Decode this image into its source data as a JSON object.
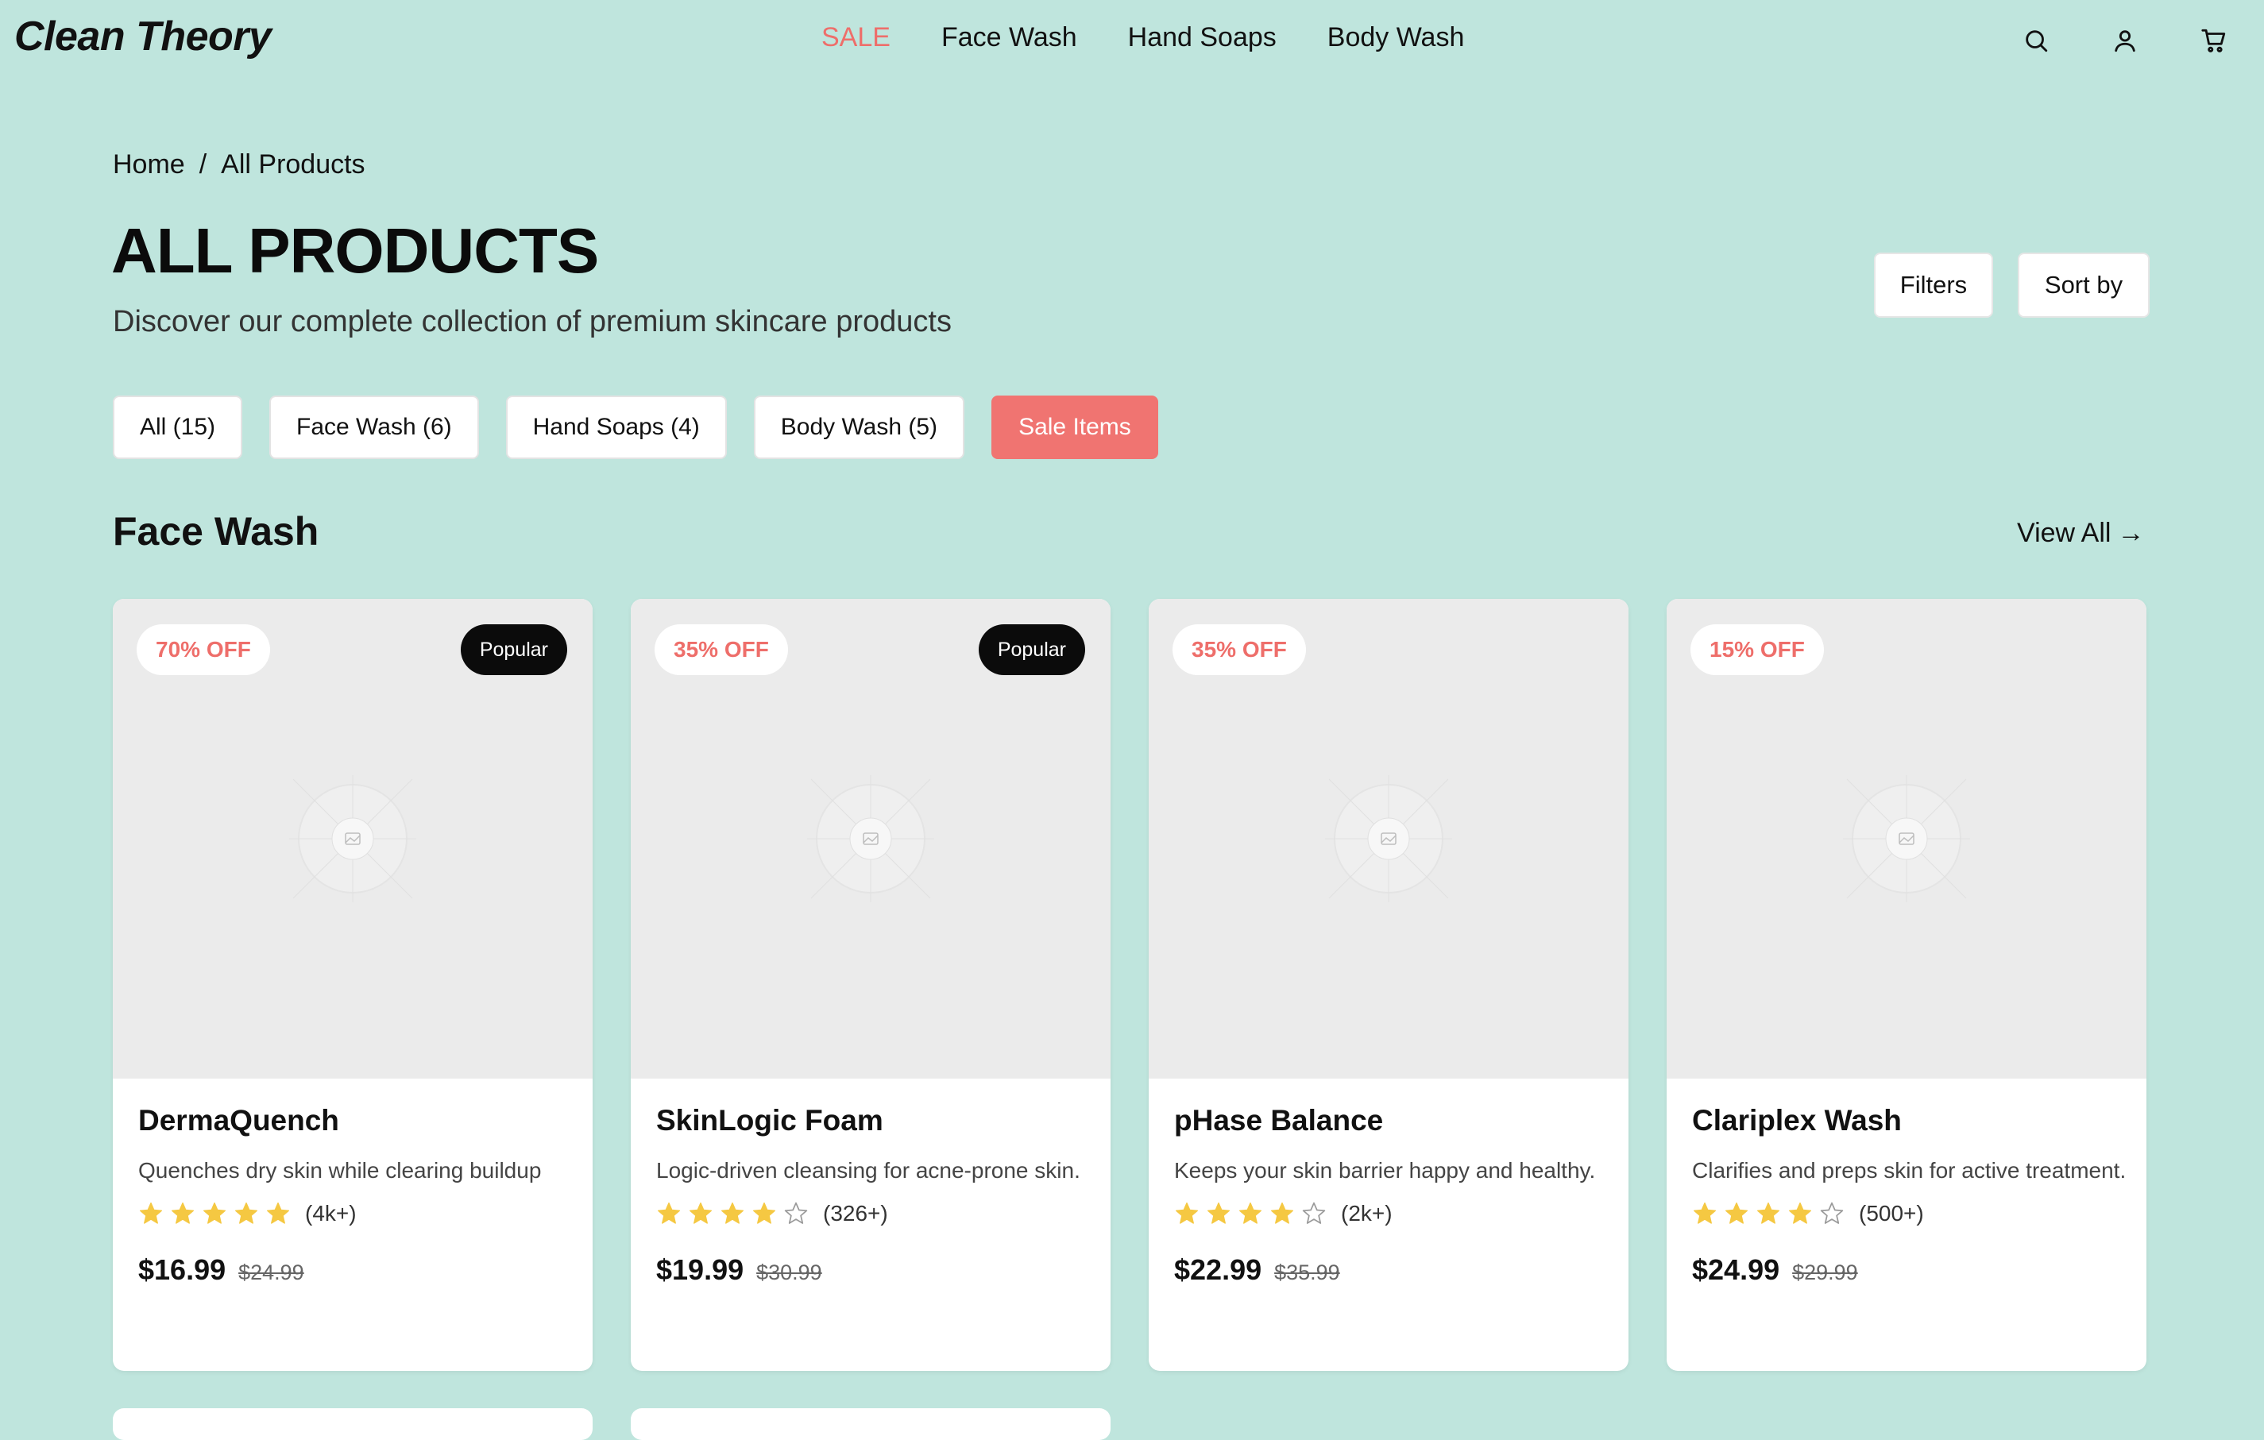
{
  "brand": "Clean Theory",
  "nav": [
    {
      "label": "SALE",
      "sale": true
    },
    {
      "label": "Face Wash"
    },
    {
      "label": "Hand Soaps"
    },
    {
      "label": "Body Wash"
    }
  ],
  "header_icons": [
    "search-icon",
    "user-icon",
    "cart-icon"
  ],
  "breadcrumb": {
    "home": "Home",
    "sep": "/",
    "current": "All Products"
  },
  "page": {
    "title": "ALL PRODUCTS",
    "subtitle": "Discover our complete collection of premium skincare products",
    "filters_label": "Filters",
    "sort_label": "Sort by"
  },
  "chips": [
    {
      "label": "All (15)"
    },
    {
      "label": "Face Wash (6)"
    },
    {
      "label": "Hand Soaps (4)"
    },
    {
      "label": "Body Wash (5)"
    },
    {
      "label": "Sale Items",
      "highlight": true
    }
  ],
  "section": {
    "title": "Face Wash",
    "view_all": "View All",
    "arrow": "→"
  },
  "products": [
    {
      "discount": "70% OFF",
      "popular": "Popular",
      "name": "DermaQuench",
      "desc": "Quenches dry skin while clearing buildup",
      "rating": 5,
      "reviews": "(4k+)",
      "price": "$16.99",
      "old_price": "$24.99"
    },
    {
      "discount": "35% OFF",
      "popular": "Popular",
      "name": "SkinLogic Foam",
      "desc": "Logic-driven cleansing for acne-prone skin.",
      "rating": 4,
      "reviews": "(326+)",
      "price": "$19.99",
      "old_price": "$30.99"
    },
    {
      "discount": "35% OFF",
      "popular": "",
      "name": "pHase Balance",
      "desc": "Keeps your skin barrier happy and healthy.",
      "rating": 4,
      "reviews": "(2k+)",
      "price": "$22.99",
      "old_price": "$35.99"
    },
    {
      "discount": "15% OFF",
      "popular": "",
      "name": "Clariplex Wash",
      "desc": "Clarifies and preps skin for active treatment.",
      "rating": 4,
      "reviews": "(500+)",
      "price": "$24.99",
      "old_price": "$29.99"
    }
  ],
  "colors": {
    "background": "#bfe5dd",
    "accent": "#ee6e6a",
    "star": "#f5c842"
  }
}
